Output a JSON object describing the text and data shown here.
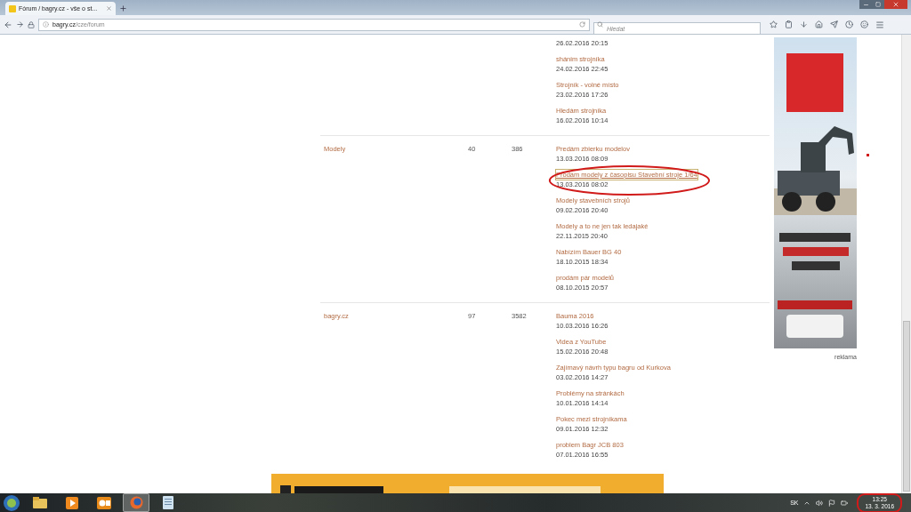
{
  "browser": {
    "tab": {
      "title": "Fórum / bagry.cz - vše o st...",
      "selected": true
    },
    "url": {
      "host": "bagry.cz",
      "path": "/cze/forum"
    },
    "search": {
      "placeholder": "Hledat"
    }
  },
  "forum": {
    "rows": [
      {
        "topics": [
          {
            "date": "26.02.2016 20:15"
          },
          {
            "title": "shánim strojníka",
            "date": "24.02.2016 22:45",
            "highlighted": false
          },
          {
            "title": "Strojník - volné místo",
            "date": "23.02.2016 17:26",
            "highlighted": false
          },
          {
            "title": "Hledám strojníka",
            "date": "16.02.2016 10:14",
            "highlighted": false
          }
        ]
      },
      {
        "name": "Modely",
        "topic_count": "40",
        "post_count": "386",
        "topics": [
          {
            "title": "Predám zbierku modelov",
            "date": "13.03.2016 08:09",
            "highlighted": false
          },
          {
            "title": "Prodám modely z časopisu Stavební stroje 1/64",
            "date": "13.03.2016 08:02",
            "highlighted": true
          },
          {
            "title": "Modely stavebních strojů",
            "date": "09.02.2016 20:40",
            "highlighted": false
          },
          {
            "title": "Modely a to ne jen tak ledajaké",
            "date": "22.11.2015 20:40",
            "highlighted": false
          },
          {
            "title": "Nabízím Bauer BG 40",
            "date": "18.10.2015 18:34",
            "highlighted": false
          },
          {
            "title": "prodám pár modelů",
            "date": "08.10.2015 20:57",
            "highlighted": false
          }
        ]
      },
      {
        "name": "bagry.cz",
        "topic_count": "97",
        "post_count": "3582",
        "topics": [
          {
            "title": "Bauma 2016",
            "date": "10.03.2016 16:26",
            "highlighted": false
          },
          {
            "title": "Videa z YouTube",
            "date": "15.02.2016 20:48",
            "highlighted": false
          },
          {
            "title": "Zajímavý návrh typu bagru od Kurkova",
            "date": "03.02.2016 14:27",
            "highlighted": false
          },
          {
            "title": "Problémy na stránkách",
            "date": "10.01.2016 14:14",
            "highlighted": false
          },
          {
            "title": "Pokec mezi strojníkama",
            "date": "09.01.2016 12:32",
            "highlighted": false
          },
          {
            "title": "problem Bagr JCB 803",
            "date": "07.01.2016 16:55",
            "highlighted": false
          }
        ]
      }
    ]
  },
  "ad": {
    "kind": "picture",
    "label": "reklama"
  },
  "taskbar": {
    "apps": [
      {
        "kind": "explorer",
        "selected": false
      },
      {
        "kind": "media",
        "selected": false
      },
      {
        "kind": "outlook",
        "selected": false
      },
      {
        "kind": "firefox",
        "selected": true
      },
      {
        "kind": "notes",
        "selected": false
      }
    ],
    "language": "SK",
    "clock": {
      "time": "13:25",
      "date": "13. 3. 2016",
      "highlighted": true
    }
  }
}
